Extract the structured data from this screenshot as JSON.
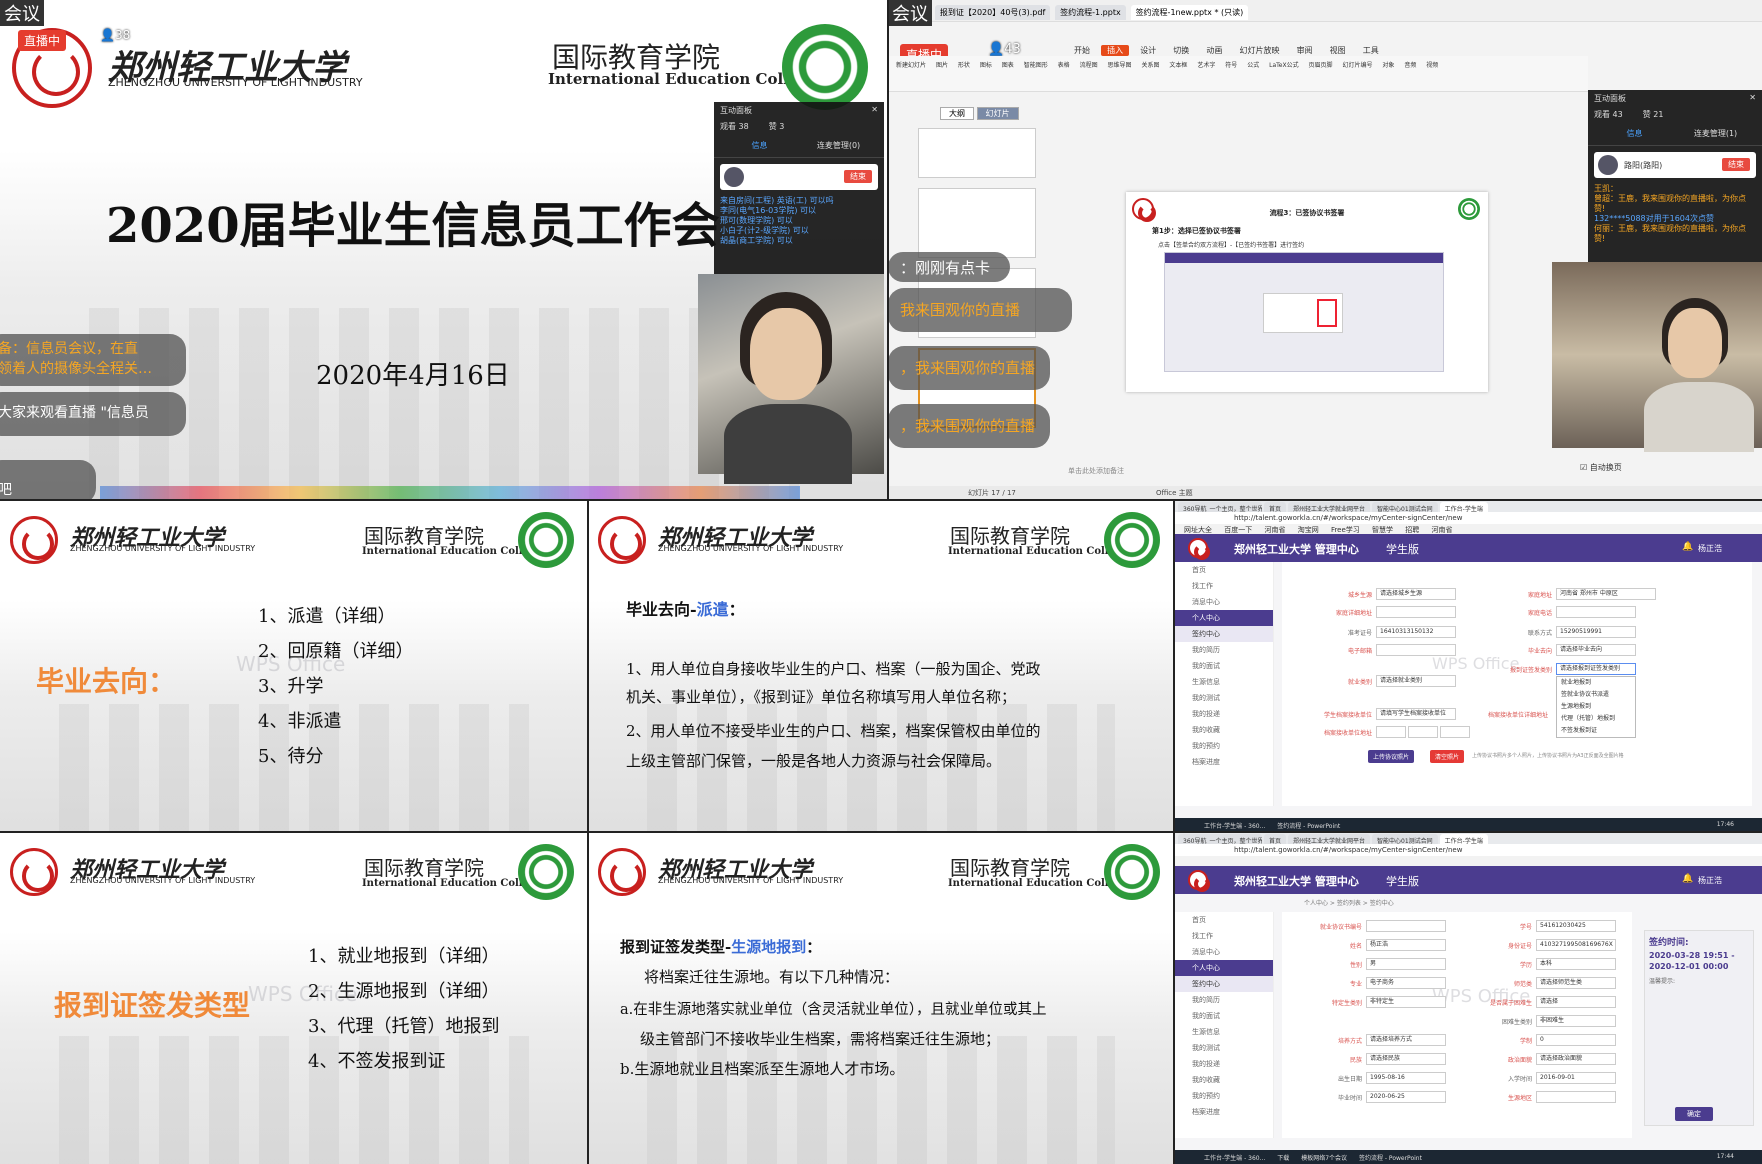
{
  "p1": {
    "corner_text": "会议",
    "live_badge": "直播中",
    "viewer_count": "38",
    "university_cn": "郑州轻工业大学",
    "university_en": "ZHENGZHOU UNIVERSITY OF LIGHT INDUSTRY",
    "college_cn": "国际教育学院",
    "college_en": "International Education College",
    "title": "2020届毕业生信息员工作会",
    "date": "2020年4月16日",
    "chat": [
      {
        "text": "备：信息员会议，在直",
        "sub": "领着人的摄像头全程关…"
      },
      {
        "text": "大家来观看直播 \"信息员"
      },
      {
        "text": "吧"
      }
    ],
    "interaction_panel": {
      "title": "互动面板",
      "viewers": "观看 38",
      "likes": "赞 3",
      "tabs": [
        "信息",
        "连麦管理(0)"
      ],
      "action": "结束",
      "messages": [
        "来自房间(工程) 英语(工) 可以吗",
        "李同(电气16-03学院) 可以",
        "邢可(数理学院) 可以",
        "小白子(计2-级学院) 可以",
        "胡晶(商工学院) 可以"
      ]
    }
  },
  "p2": {
    "corner_text": "会议",
    "live_badge": "直播中",
    "viewer_count": "43",
    "file_tabs": [
      "报到证【2020】40号(3).pdf",
      "签约流程-1.pptx",
      "签约流程-1new.pptx * (只读)"
    ],
    "ribbon_tabs": [
      "开始",
      "插入",
      "设计",
      "切换",
      "动画",
      "幻灯片放映",
      "审阅",
      "视图",
      "工具"
    ],
    "ribbon_items": [
      "新建幻灯片",
      "图片",
      "形状",
      "图标",
      "图表",
      "智能图形",
      "表格",
      "流程图",
      "思维导图",
      "关系图",
      "文本框",
      "艺术字",
      "符号",
      "公式",
      "LaTeX公式",
      "页眉页脚",
      "幻灯片编号",
      "对象",
      "音频",
      "视频"
    ],
    "outline_tabs": [
      "大纲",
      "幻灯片"
    ],
    "slide_heading": "流程3：已签协议书签署",
    "slide_step": "第1步：选择已签协议书签署",
    "slide_note": "点击【签单合约双方流程】-【已签约书签署】进行签约",
    "slide_counter": "幻灯片 17 / 17",
    "office_theme": "Office 主题",
    "notes_hint": "单击此处添加备注",
    "chat": [
      {
        "text": "：刚刚有点卡"
      },
      {
        "text": "我来围观你的直播"
      },
      {
        "text": "，我来围观你的直播"
      },
      {
        "text": "，我来围观你的直播"
      }
    ],
    "interaction_panel": {
      "title": "互动面板",
      "viewers": "观看 43",
      "likes": "赞 21",
      "tabs": [
        "信息",
        "连麦管理(1)"
      ],
      "user": "路阳(路阳)",
      "action": "结束",
      "messages": [
        "王凯：",
        "曾超：王鹿，我来围观你的直播啦，为你点赞!",
        "132****5088对用于1604次点赞",
        "何丽：王鹿，我来围观你的直播啦，为你点赞!"
      ],
      "toggle": "自动换页"
    }
  },
  "p3": {
    "university_cn": "郑州轻工业大学",
    "university_en": "ZHENGZHOU UNIVERSITY OF LIGHT INDUSTRY",
    "college_cn": "国际教育学院",
    "college_en": "International Education College",
    "heading": "毕业去向：",
    "watermark": "WPS Office",
    "items": [
      "1、派遣（详细）",
      "2、回原籍（详细）",
      "3、升学",
      "4、非派遣",
      "5、待分"
    ]
  },
  "p4": {
    "university_cn": "郑州轻工业大学",
    "university_en": "ZHENGZHOU UNIVERSITY OF LIGHT INDUSTRY",
    "college_cn": "国际教育学院",
    "college_en": "International Education College",
    "heading_prefix": "毕业去向-",
    "heading_hl": "派遣",
    "heading_suffix": "：",
    "lines": [
      "1、用人单位自身接收毕业生的户口、档案（一般为国企、党政",
      "机关、事业单位），《报到证》单位名称填写用人单位名称；",
      "2、用人单位不接受毕业生的户口、档案，档案保管权由单位的",
      "上级主管部门保管，一般是各地人力资源与社会保障局。"
    ]
  },
  "p5": {
    "tabs": [
      "360导航_一个主页，整个世界",
      "首页",
      "郑州轻工业大学就业网平台",
      "智能中心01测试合同",
      "工作台-学生端"
    ],
    "url": "http://talent.goworkla.cn/#/workspace/myCenter-signCenter/new",
    "bookmarks": [
      "网址大全",
      "百度一下",
      "河南省",
      "淘宝网",
      "Free学习",
      "智慧学",
      "招聘",
      "河南省",
      "新工作",
      "淘宝网"
    ],
    "app_title": "郑州轻工业大学 管理中心",
    "app_sub": "学生版",
    "user": "杨正浩",
    "watermark": "WPS Office",
    "sidebar": [
      "首页",
      "找工作",
      "消息中心",
      "个人中心",
      "签约中心",
      "我的简历",
      "我的面试",
      "生源信息",
      "我的测试",
      "我的投递",
      "我的收藏",
      "我的预约",
      "档案进度"
    ],
    "fields": [
      {
        "label": "城乡生源",
        "value": "请选择城乡生源"
      },
      {
        "label": "家庭地址",
        "value": "河南省  郑州市  中原区"
      },
      {
        "label": "家庭详细地址",
        "value": ""
      },
      {
        "label": "家庭电话",
        "value": ""
      },
      {
        "label": "准考证号",
        "value": "16410313150132"
      },
      {
        "label": "联系方式",
        "value": "15290519991"
      },
      {
        "label": "电子邮箱",
        "value": ""
      },
      {
        "label": "毕业去向",
        "value": "请选择毕业去向"
      },
      {
        "label": "报到证签发类别",
        "value": "请选择报到证签发类别"
      },
      {
        "label": "就业类别",
        "value": "请选择就业类别"
      },
      {
        "label": "学生档案接收单位",
        "value": "请填写学生档案接收单位"
      },
      {
        "label": "档案接收单位详细地址",
        "value": ""
      },
      {
        "label": "档案接收单位地址",
        "value": ""
      }
    ],
    "dropdown": [
      "就业地报到",
      "签就业协议书派遣",
      "生源地报到",
      "代理（托管）地报到",
      "不签发报到证"
    ],
    "btn_upload": "上传协议照片",
    "btn_clear": "清空照片",
    "upload_hint": "上传协议书照片多个人照片，上传协议书照片为A3正反面及全图片格",
    "taskbar": [
      "工作台-学生端 - 360...",
      "签约流程 - PowerPoint"
    ],
    "time": "17:46"
  },
  "p6": {
    "university_cn": "郑州轻工业大学",
    "university_en": "ZHENGZHOU UNIVERSITY OF LIGHT INDUSTRY",
    "college_cn": "国际教育学院",
    "college_en": "International Education College",
    "heading": "报到证签发类型",
    "watermark": "WPS Office",
    "items": [
      "1、就业地报到（详细）",
      "2、生源地报到（详细）",
      "3、代理（托管）地报到",
      "4、不签发报到证"
    ]
  },
  "p7": {
    "university_cn": "郑州轻工业大学",
    "university_en": "ZHENGZHOU UNIVERSITY OF LIGHT INDUSTRY",
    "college_cn": "国际教育学院",
    "college_en": "International Education College",
    "heading_prefix": "报到证签发类型-",
    "heading_hl": "生源地报到",
    "heading_suffix": "：",
    "lines": [
      "将档案迁往生源地。有以下几种情况：",
      "a.在非生源地落实就业单位（含灵活就业单位），且就业单位或其上",
      "级主管部门不接收毕业生档案，需将档案迁往生源地；",
      "b.生源地就业且档案派至生源地人才市场。"
    ]
  },
  "p8": {
    "tabs": [
      "360导航_一个主页，整个世界",
      "首页",
      "郑州轻工业大学就业网平台",
      "智能中心01测试合同",
      "工作台-学生端"
    ],
    "url": "http://talent.goworkla.cn/#/workspace/myCenter-signCenter/new",
    "app_title": "郑州轻工业大学 管理中心",
    "app_sub": "学生版",
    "user": "杨正浩",
    "watermark": "WPS Office",
    "breadcrumb": [
      "个人中心",
      "签约列表",
      "签约中心"
    ],
    "sidebar": [
      "首页",
      "找工作",
      "消息中心",
      "个人中心",
      "签约中心",
      "我的简历",
      "我的面试",
      "生源信息",
      "我的测试",
      "我的投递",
      "我的收藏",
      "我的预约",
      "档案进度"
    ],
    "fields": [
      {
        "label": "就业协议书编号",
        "value": ""
      },
      {
        "label": "学号",
        "value": "541612030425"
      },
      {
        "label": "姓名",
        "value": "杨正浩"
      },
      {
        "label": "身份证号",
        "value": "410327199508169676X"
      },
      {
        "label": "性别",
        "value": "男"
      },
      {
        "label": "学历",
        "value": "本科"
      },
      {
        "label": "专业",
        "value": "电子商务"
      },
      {
        "label": "师范类",
        "value": "请选择师范生类"
      },
      {
        "label": "特定生类别",
        "value": "非特定生"
      },
      {
        "label": "是否属于困难生",
        "value": "请选择"
      },
      {
        "label": "困难生类别",
        "value": "非困难生"
      },
      {
        "label": "培养方式",
        "value": "请选择培养方式"
      },
      {
        "label": "学制",
        "value": "0"
      },
      {
        "label": "民族",
        "value": "请选择民族"
      },
      {
        "label": "政治面貌",
        "value": "请选择政治面貌"
      },
      {
        "label": "出生日期",
        "value": "1995-08-16"
      },
      {
        "label": "入学时间",
        "value": "2016-09-01"
      },
      {
        "label": "毕业时间",
        "value": "2020-06-25"
      },
      {
        "label": "生源地区",
        "value": ""
      }
    ],
    "sign_time_label": "签约时间:",
    "sign_time": "2020-03-28 19:51 - 2020-12-01 00:00",
    "note_label": "温馨提示:",
    "confirm": "确定",
    "taskbar": [
      "工作台-学生端 - 360...",
      "下载",
      "模板网络7个会议",
      "签约流程 - PowerPoint"
    ],
    "time": "17:44"
  }
}
